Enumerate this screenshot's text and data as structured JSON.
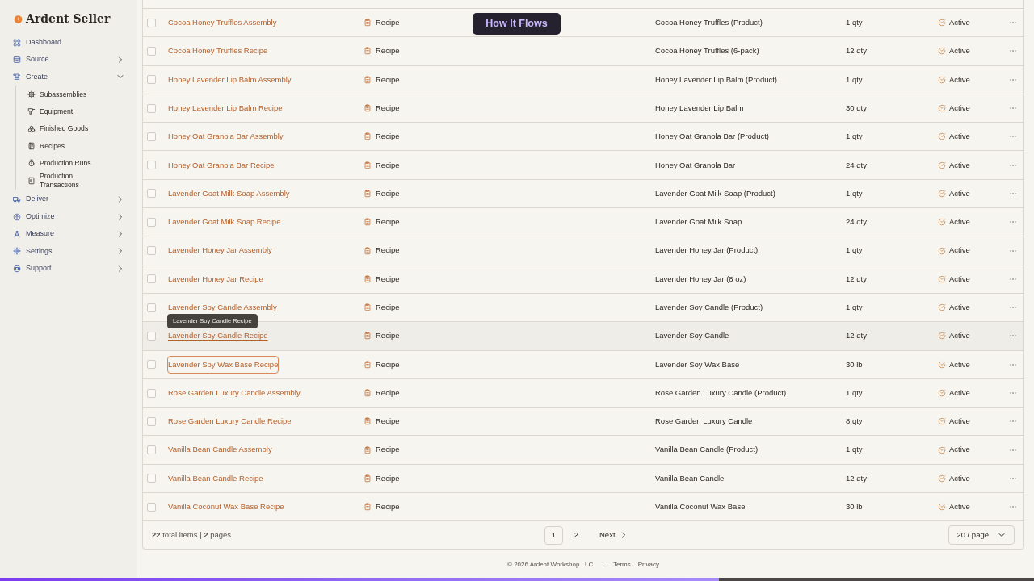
{
  "brand": "Ardent Seller",
  "nav": [
    {
      "label": "Dashboard"
    },
    {
      "label": "Source",
      "expanded": false
    },
    {
      "label": "Create",
      "expanded": true,
      "children": [
        {
          "label": "Subassemblies"
        },
        {
          "label": "Equipment"
        },
        {
          "label": "Finished Goods"
        },
        {
          "label": "Recipes"
        },
        {
          "label": "Production Runs"
        },
        {
          "label": "Production Transactions"
        }
      ]
    },
    {
      "label": "Deliver",
      "expanded": false
    },
    {
      "label": "Optimize",
      "expanded": false
    },
    {
      "label": "Measure",
      "expanded": false
    },
    {
      "label": "Settings",
      "expanded": false
    },
    {
      "label": "Support",
      "expanded": false
    }
  ],
  "overlay_button": "How It Flows",
  "rows": [
    {
      "checked": false,
      "name": "Cocoa Honey Truffles Assembly",
      "type": "Recipe",
      "product": "Cocoa Honey Truffles (Product)",
      "yield": "1 qty",
      "status": "Active",
      "hovered": false,
      "focused": false
    },
    {
      "checked": false,
      "name": "Cocoa Honey Truffles Recipe",
      "type": "Recipe",
      "product": "Cocoa Honey Truffles (6-pack)",
      "yield": "12 qty",
      "status": "Active",
      "hovered": false,
      "focused": false
    },
    {
      "checked": false,
      "name": "Honey Lavender Lip Balm Assembly",
      "type": "Recipe",
      "product": "Honey Lavender Lip Balm (Product)",
      "yield": "1 qty",
      "status": "Active",
      "hovered": false,
      "focused": false
    },
    {
      "checked": false,
      "name": "Honey Lavender Lip Balm Recipe",
      "type": "Recipe",
      "product": "Honey Lavender Lip Balm",
      "yield": "30 qty",
      "status": "Active",
      "hovered": false,
      "focused": false
    },
    {
      "checked": false,
      "name": "Honey Oat Granola Bar Assembly",
      "type": "Recipe",
      "product": "Honey Oat Granola Bar (Product)",
      "yield": "1 qty",
      "status": "Active",
      "hovered": false,
      "focused": false
    },
    {
      "checked": false,
      "name": "Honey Oat Granola Bar Recipe",
      "type": "Recipe",
      "product": "Honey Oat Granola Bar",
      "yield": "24 qty",
      "status": "Active",
      "hovered": false,
      "focused": false
    },
    {
      "checked": false,
      "name": "Lavender Goat Milk Soap Assembly",
      "type": "Recipe",
      "product": "Lavender Goat Milk Soap (Product)",
      "yield": "1 qty",
      "status": "Active",
      "hovered": false,
      "focused": false
    },
    {
      "checked": false,
      "name": "Lavender Goat Milk Soap Recipe",
      "type": "Recipe",
      "product": "Lavender Goat Milk Soap",
      "yield": "24 qty",
      "status": "Active",
      "hovered": false,
      "focused": false
    },
    {
      "checked": false,
      "name": "Lavender Honey Jar Assembly",
      "type": "Recipe",
      "product": "Lavender Honey Jar (Product)",
      "yield": "1 qty",
      "status": "Active",
      "hovered": false,
      "focused": false
    },
    {
      "checked": false,
      "name": "Lavender Honey Jar Recipe",
      "type": "Recipe",
      "product": "Lavender Honey Jar (8 oz)",
      "yield": "12 qty",
      "status": "Active",
      "hovered": false,
      "focused": false
    },
    {
      "checked": false,
      "name": "Lavender Soy Candle Assembly",
      "type": "Recipe",
      "product": "Lavender Soy Candle (Product)",
      "yield": "1 qty",
      "status": "Active",
      "hovered": false,
      "focused": false
    },
    {
      "checked": false,
      "name": "Lavender Soy Candle Recipe",
      "type": "Recipe",
      "product": "Lavender Soy Candle",
      "yield": "12 qty",
      "status": "Active",
      "hovered": true,
      "focused": false,
      "tooltip": "Lavender Soy Candle Recipe"
    },
    {
      "checked": false,
      "name": "Lavender Soy Wax Base Recipe",
      "type": "Recipe",
      "product": "Lavender Soy Wax Base",
      "yield": "30 lb",
      "status": "Active",
      "hovered": false,
      "focused": true
    },
    {
      "checked": false,
      "name": "Rose Garden Luxury Candle Assembly",
      "type": "Recipe",
      "product": "Rose Garden Luxury Candle (Product)",
      "yield": "1 qty",
      "status": "Active",
      "hovered": false,
      "focused": false
    },
    {
      "checked": false,
      "name": "Rose Garden Luxury Candle Recipe",
      "type": "Recipe",
      "product": "Rose Garden Luxury Candle",
      "yield": "8 qty",
      "status": "Active",
      "hovered": false,
      "focused": false
    },
    {
      "checked": false,
      "name": "Vanilla Bean Candle Assembly",
      "type": "Recipe",
      "product": "Vanilla Bean Candle (Product)",
      "yield": "1 qty",
      "status": "Active",
      "hovered": false,
      "focused": false
    },
    {
      "checked": false,
      "name": "Vanilla Bean Candle Recipe",
      "type": "Recipe",
      "product": "Vanilla Bean Candle",
      "yield": "12 qty",
      "status": "Active",
      "hovered": false,
      "focused": false
    },
    {
      "checked": false,
      "name": "Vanilla Coconut Wax Base Recipe",
      "type": "Recipe",
      "product": "Vanilla Coconut Wax Base",
      "yield": "30 lb",
      "status": "Active",
      "hovered": false,
      "focused": false
    }
  ],
  "summary": "**22** total items | **2** pages",
  "pages": [
    {
      "label": "1",
      "selected": true
    },
    {
      "label": "2",
      "selected": false
    }
  ],
  "next": "Next",
  "page_size": "20 / page",
  "footer": {
    "copyright": "© 2026 Ardent Workshop LLC",
    "separator": "·",
    "links": [
      "Terms",
      "Privacy"
    ]
  },
  "progress": {
    "level": 0.695
  }
}
